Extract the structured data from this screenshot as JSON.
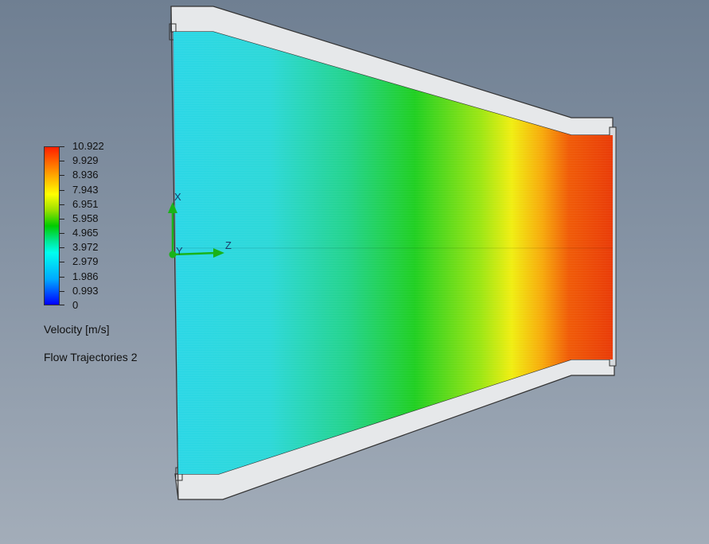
{
  "legend": {
    "title": "Velocity [m/s]",
    "ticks": [
      "10.922",
      "9.929",
      "8.936",
      "7.943",
      "6.951",
      "5.958",
      "4.965",
      "3.972",
      "2.979",
      "1.986",
      "0.993",
      "0"
    ],
    "colors": {
      "top": "#ff1e00",
      "upper": "#ffff00",
      "mid": "#00cc00",
      "lower": "#00ffff",
      "bottom": "#0000ff"
    }
  },
  "plot": {
    "name": "Flow Trajectories 2"
  },
  "triad": {
    "x_label": "X",
    "y_label": "Y",
    "z_label": "Z",
    "color": "#19b319"
  },
  "flow_colors": {
    "inlet": "#2ad7e6",
    "middle": "#1fd01f",
    "yellow": "#f0ee10",
    "outlet": "#ee3a08"
  }
}
